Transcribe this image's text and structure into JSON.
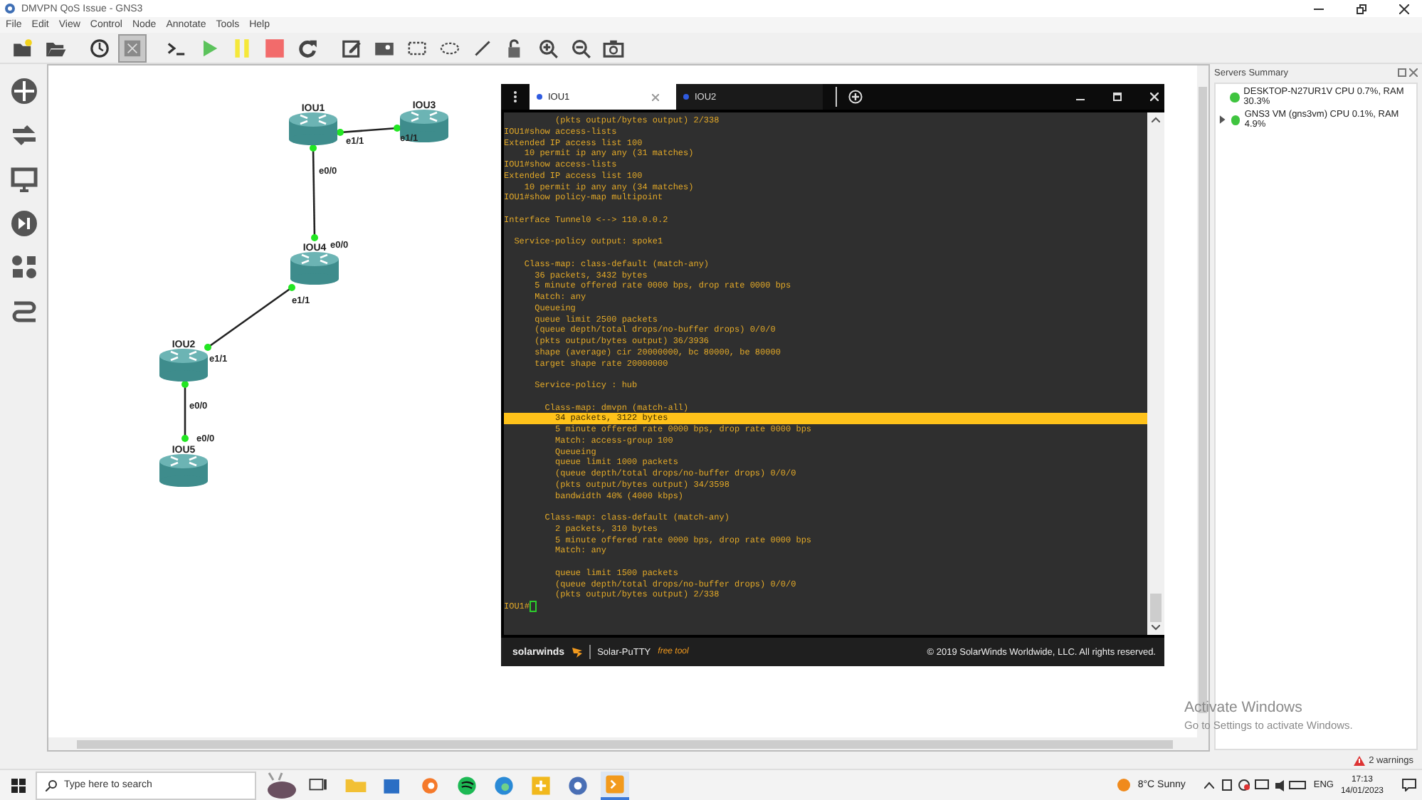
{
  "window": {
    "title": "DMVPN QoS Issue - GNS3"
  },
  "menu": [
    {
      "label": "File",
      "disabled": false
    },
    {
      "label": "Edit",
      "disabled": false
    },
    {
      "label": "View",
      "disabled": false
    },
    {
      "label": "Control",
      "disabled": false
    },
    {
      "label": "Node",
      "disabled": false
    },
    {
      "label": "Annotate",
      "disabled": false
    },
    {
      "label": "Tools",
      "disabled": false
    },
    {
      "label": "Help",
      "disabled": false
    }
  ],
  "toolbar": [
    {
      "kind": "new",
      "pressed": false
    },
    {
      "kind": "open",
      "pressed": false
    },
    {
      "kind": "separator"
    },
    {
      "kind": "snapshot",
      "pressed": false
    },
    {
      "kind": "interface-labels",
      "pressed": true
    },
    {
      "kind": "separator"
    },
    {
      "kind": "console",
      "pressed": false
    },
    {
      "kind": "start",
      "pressed": false
    },
    {
      "kind": "suspend",
      "pressed": false
    },
    {
      "kind": "stop",
      "pressed": false
    },
    {
      "kind": "reload",
      "pressed": false
    },
    {
      "kind": "separator"
    },
    {
      "kind": "note",
      "pressed": false
    },
    {
      "kind": "picture",
      "pressed": false
    },
    {
      "kind": "rectangle",
      "pressed": false
    },
    {
      "kind": "ellipse",
      "pressed": false
    },
    {
      "kind": "line",
      "pressed": false
    },
    {
      "kind": "lock",
      "pressed": false
    },
    {
      "kind": "zoom-in",
      "pressed": false
    },
    {
      "kind": "zoom-out",
      "pressed": false
    },
    {
      "kind": "screenshot",
      "pressed": false
    }
  ],
  "topology": {
    "nodes": [
      {
        "name": "IOU1"
      },
      {
        "name": "IOU3"
      },
      {
        "name": "IOU4"
      },
      {
        "name": "IOU2"
      },
      {
        "name": "IOU5"
      }
    ],
    "links": [
      {
        "ports": [
          "e1/1",
          "e1/1"
        ],
        "up": true
      },
      {
        "ports": [
          "e0/0",
          "e0/0"
        ],
        "up": true
      },
      {
        "ports": [
          "e1/1",
          "e1/1"
        ],
        "up": true
      },
      {
        "ports": [
          "e0/0",
          "e0/0"
        ],
        "up": true
      }
    ]
  },
  "terminal": {
    "tabs": [
      {
        "label": "IOU1",
        "selected": true
      },
      {
        "label": "IOU2",
        "selected": false
      }
    ],
    "blocks": [
      [
        {
          "text": "          (pkts output/bytes output) 2/338",
          "highlighted": false
        },
        {
          "text": "IOU1#show access-lists",
          "highlighted": false
        },
        {
          "text": "Extended IP access list 100",
          "highlighted": false
        },
        {
          "text": "    10 permit ip any any (31 matches)",
          "highlighted": false
        },
        {
          "text": "IOU1#show access-lists",
          "highlighted": false
        },
        {
          "text": "Extended IP access list 100",
          "highlighted": false
        },
        {
          "text": "    10 permit ip any any (34 matches)",
          "highlighted": false
        },
        {
          "text": "IOU1#show policy-map multipoint",
          "highlighted": false
        }
      ],
      [
        {
          "text": "Interface Tunnel0 <--> 110.0.0.2",
          "highlighted": false
        }
      ],
      [
        {
          "text": "  Service-policy output: spoke1",
          "highlighted": false
        }
      ],
      [
        {
          "text": "    Class-map: class-default (match-any)",
          "highlighted": false
        },
        {
          "text": "      36 packets, 3432 bytes",
          "highlighted": false
        },
        {
          "text": "      5 minute offered rate 0000 bps, drop rate 0000 bps",
          "highlighted": false
        },
        {
          "text": "      Match: any",
          "highlighted": false
        },
        {
          "text": "      Queueing",
          "highlighted": false
        },
        {
          "text": "      queue limit 2500 packets",
          "highlighted": false
        },
        {
          "text": "      (queue depth/total drops/no-buffer drops) 0/0/0",
          "highlighted": false
        },
        {
          "text": "      (pkts output/bytes output) 36/3936",
          "highlighted": false
        },
        {
          "text": "      shape (average) cir 20000000, bc 80000, be 80000",
          "highlighted": false
        },
        {
          "text": "      target shape rate 20000000",
          "highlighted": false
        }
      ],
      [
        {
          "text": "      Service-policy : hub",
          "highlighted": false
        }
      ],
      [
        {
          "text": "        Class-map: dmvpn (match-all)",
          "highlighted": false
        },
        {
          "text": "          34 packets, 3122 bytes",
          "highlighted": true
        },
        {
          "text": "          5 minute offered rate 0000 bps, drop rate 0000 bps",
          "highlighted": false
        },
        {
          "text": "          Match: access-group 100",
          "highlighted": false
        },
        {
          "text": "          Queueing",
          "highlighted": false
        },
        {
          "text": "          queue limit 1000 packets",
          "highlighted": false
        },
        {
          "text": "          (queue depth/total drops/no-buffer drops) 0/0/0",
          "highlighted": false
        },
        {
          "text": "          (pkts output/bytes output) 34/3598",
          "highlighted": false
        },
        {
          "text": "          bandwidth 40% (4000 kbps)",
          "highlighted": false
        }
      ],
      [
        {
          "text": "        Class-map: class-default (match-any)",
          "highlighted": false
        },
        {
          "text": "          2 packets, 310 bytes",
          "highlighted": false
        },
        {
          "text": "          5 minute offered rate 0000 bps, drop rate 0000 bps",
          "highlighted": false
        },
        {
          "text": "          Match: any",
          "highlighted": false
        }
      ],
      [
        {
          "text": "          queue limit 1500 packets",
          "highlighted": false
        },
        {
          "text": "          (queue depth/total drops/no-buffer drops) 0/0/0",
          "highlighted": false
        },
        {
          "text": "          (pkts output/bytes output) 2/338",
          "highlighted": false
        },
        {
          "text": "IOU1#",
          "highlighted": false
        }
      ]
    ],
    "footer": {
      "brand": "solarwinds",
      "product": "Solar-PuTTY",
      "tag": "free tool",
      "copyright": "© 2019 SolarWinds Worldwide, LLC. All rights reserved."
    }
  },
  "servers_summary": {
    "title": "Servers Summary",
    "servers": [
      {
        "text": "DESKTOP-N27UR1V CPU 0.7%, RAM 30.3%",
        "running": true,
        "expandable": false
      },
      {
        "text": "GNS3 VM (gns3vm) CPU 0.1%, RAM 4.9%",
        "running": true,
        "expandable": true
      }
    ]
  },
  "activation": {
    "title": "Activate Windows",
    "message": "Go to Settings to activate Windows."
  },
  "status_bar": {
    "warnings": "2 warnings"
  },
  "taskbar": {
    "search_placeholder": "Type here to search",
    "weather": "8°C  Sunny",
    "language": "ENG",
    "time": "17:13",
    "date": "14/01/2023"
  }
}
